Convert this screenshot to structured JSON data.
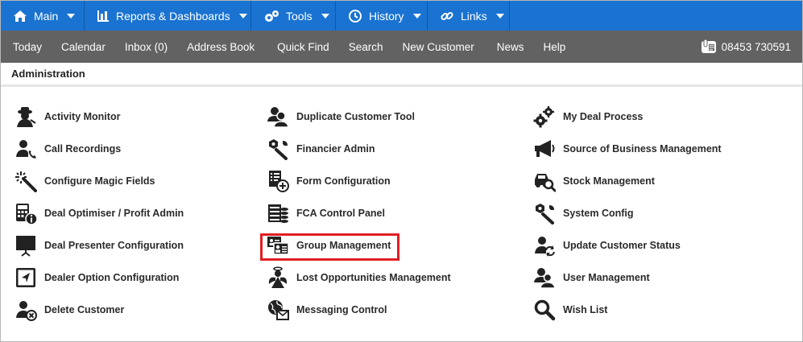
{
  "topnav": {
    "items": [
      {
        "label": "Main",
        "icon": "home-icon"
      },
      {
        "label": "Reports & Dashboards",
        "icon": "bar-chart-icon"
      },
      {
        "label": "Tools",
        "icon": "gears-icon"
      },
      {
        "label": "History",
        "icon": "history-icon"
      },
      {
        "label": "Links",
        "icon": "link-icon"
      }
    ]
  },
  "subnav": {
    "items": [
      "Today",
      "Calendar",
      "Inbox (0)",
      "Address Book",
      "Quick Find",
      "Search",
      "New Customer",
      "News",
      "Help"
    ],
    "phone": "08453 730591"
  },
  "section": {
    "title": "Administration"
  },
  "admin": {
    "col1": [
      {
        "label": "Activity Monitor",
        "icon": "detective-icon"
      },
      {
        "label": "Call Recordings",
        "icon": "user-phone-icon"
      },
      {
        "label": "Configure Magic Fields",
        "icon": "magic-wand-icon"
      },
      {
        "label": "Deal Optimiser / Profit Admin",
        "icon": "calculator-info-icon"
      },
      {
        "label": "Deal Presenter Configuration",
        "icon": "presentation-board-icon"
      },
      {
        "label": "Dealer Option Configuration",
        "icon": "dealer-option-icon"
      },
      {
        "label": "Delete Customer",
        "icon": "user-delete-icon"
      }
    ],
    "col2": [
      {
        "label": "Duplicate Customer Tool",
        "icon": "users-duplicate-icon"
      },
      {
        "label": "Financier Admin",
        "icon": "user-wrench-icon"
      },
      {
        "label": "Form Configuration",
        "icon": "form-add-icon"
      },
      {
        "label": "FCA Control Panel",
        "icon": "control-panel-icon"
      },
      {
        "label": "Group Management",
        "icon": "id-cards-icon"
      },
      {
        "label": "Lost Opportunities Management",
        "icon": "angel-icon"
      },
      {
        "label": "Messaging Control",
        "icon": "globe-mail-icon"
      }
    ],
    "col3": [
      {
        "label": "My Deal Process",
        "icon": "gears-icon"
      },
      {
        "label": "Source of Business Management",
        "icon": "megaphone-icon"
      },
      {
        "label": "Stock Management",
        "icon": "car-search-icon"
      },
      {
        "label": "System Config",
        "icon": "system-wrench-icon"
      },
      {
        "label": "Update Customer Status",
        "icon": "user-refresh-icon"
      },
      {
        "label": "User Management",
        "icon": "users-icon"
      },
      {
        "label": "Wish List",
        "icon": "magnifier-icon"
      }
    ]
  },
  "colors": {
    "topnav_bg": "#1a73d1",
    "subnav_bg": "#626262",
    "highlight": "#e01e24"
  }
}
